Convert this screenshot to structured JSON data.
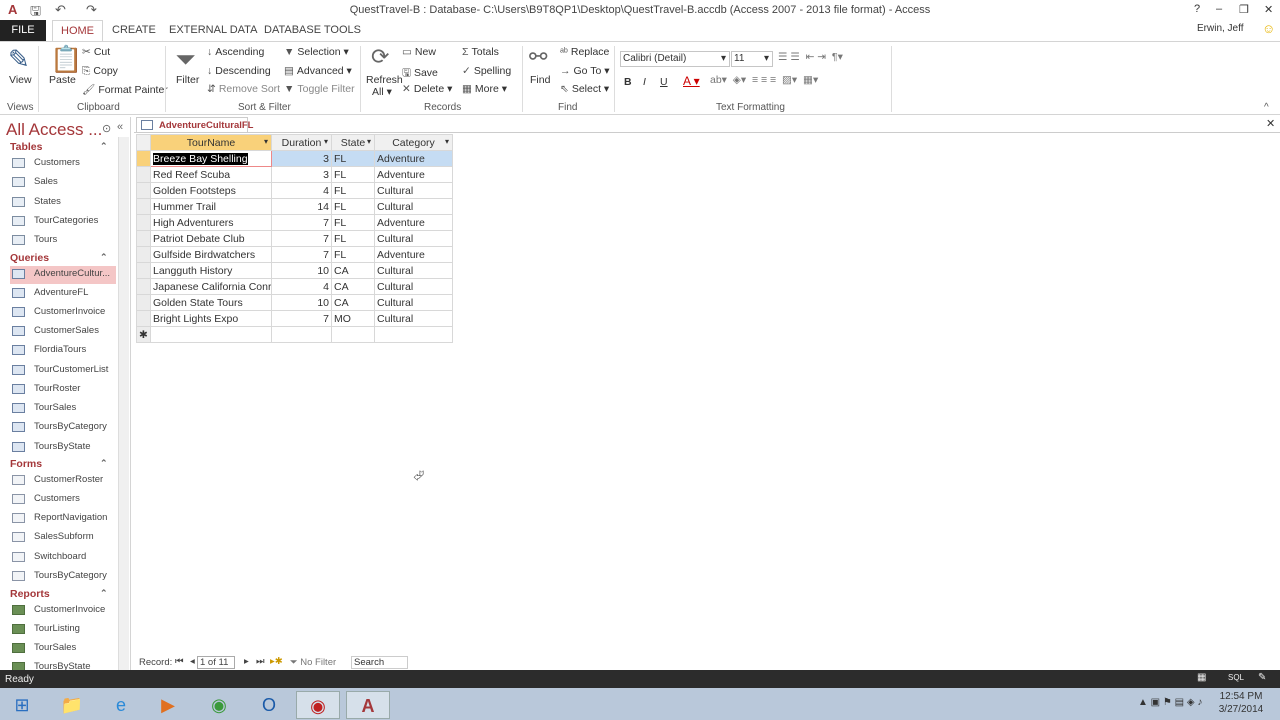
{
  "window": {
    "title": "QuestTravel-B : Database- C:\\Users\\B9T8QP1\\Desktop\\QuestTravel-B.accdb (Access 2007 - 2013 file format) - Access",
    "user": "Erwin, Jeff",
    "help": "?",
    "minimize": "–",
    "restore": "❐",
    "close": "✕"
  },
  "tabs": [
    "FILE",
    "HOME",
    "CREATE",
    "EXTERNAL DATA",
    "DATABASE TOOLS"
  ],
  "ribbon": {
    "views": {
      "view": "View",
      "group": "Views"
    },
    "clipboard": {
      "paste": "Paste",
      "cut": "Cut",
      "copy": "Copy",
      "format_painter": "Format Painter",
      "group": "Clipboard"
    },
    "sort_filter": {
      "filter": "Filter",
      "ascending": "Ascending",
      "descending": "Descending",
      "remove_sort": "Remove Sort",
      "selection": "Selection",
      "advanced": "Advanced",
      "toggle_filter": "Toggle Filter",
      "group": "Sort & Filter"
    },
    "records": {
      "refresh": "Refresh",
      "refresh2": "All",
      "new": "New",
      "save": "Save",
      "delete": "Delete",
      "totals": "Totals",
      "spelling": "Spelling",
      "more": "More",
      "group": "Records"
    },
    "find": {
      "find": "Find",
      "replace": "Replace",
      "goto": "Go To",
      "select": "Select",
      "group": "Find"
    },
    "text_formatting": {
      "font": "Calibri (Detail)",
      "size": "11",
      "bold": "B",
      "italic": "I",
      "underline": "U",
      "group": "Text Formatting"
    }
  },
  "nav": {
    "title": "All Access ...",
    "groups": [
      {
        "label": "Tables",
        "items": [
          "Customers",
          "Sales",
          "States",
          "TourCategories",
          "Tours"
        ]
      },
      {
        "label": "Queries",
        "items": [
          "AdventureCultur...",
          "AdventureFL",
          "CustomerInvoice",
          "CustomerSales",
          "FlordiaTours",
          "TourCustomerList",
          "TourRoster",
          "TourSales",
          "ToursByCategory",
          "ToursByState"
        ]
      },
      {
        "label": "Forms",
        "items": [
          "CustomerRoster",
          "Customers",
          "ReportNavigation",
          "SalesSubform",
          "Switchboard",
          "ToursByCategory"
        ]
      },
      {
        "label": "Reports",
        "items": [
          "CustomerInvoice",
          "TourListing",
          "TourSales",
          "ToursByState"
        ]
      }
    ]
  },
  "document": {
    "tab": "AdventureCulturalFL",
    "columns": [
      "TourName",
      "Duration",
      "State",
      "Category"
    ],
    "rows": [
      [
        "Breeze Bay Shelling",
        3,
        "FL",
        "Adventure"
      ],
      [
        "Red Reef Scuba",
        3,
        "FL",
        "Adventure"
      ],
      [
        "Golden Footsteps",
        4,
        "FL",
        "Cultural"
      ],
      [
        "Hummer Trail",
        14,
        "FL",
        "Cultural"
      ],
      [
        "High Adventurers",
        7,
        "FL",
        "Adventure"
      ],
      [
        "Patriot Debate Club",
        7,
        "FL",
        "Cultural"
      ],
      [
        "Gulfside Birdwatchers",
        7,
        "FL",
        "Adventure"
      ],
      [
        "Langguth History",
        10,
        "CA",
        "Cultural"
      ],
      [
        "Japanese California Conr",
        4,
        "CA",
        "Cultural"
      ],
      [
        "Golden State Tours",
        10,
        "CA",
        "Cultural"
      ],
      [
        "Bright Lights Expo",
        7,
        "MO",
        "Cultural"
      ]
    ],
    "new_row_marker": "✱"
  },
  "record_nav": {
    "label": "Record:",
    "position": "1 of 11",
    "filter": "No Filter",
    "search": "Search"
  },
  "status": {
    "text": "Ready"
  },
  "taskbar": {
    "time": "12:54 PM",
    "date": "3/27/2014"
  }
}
